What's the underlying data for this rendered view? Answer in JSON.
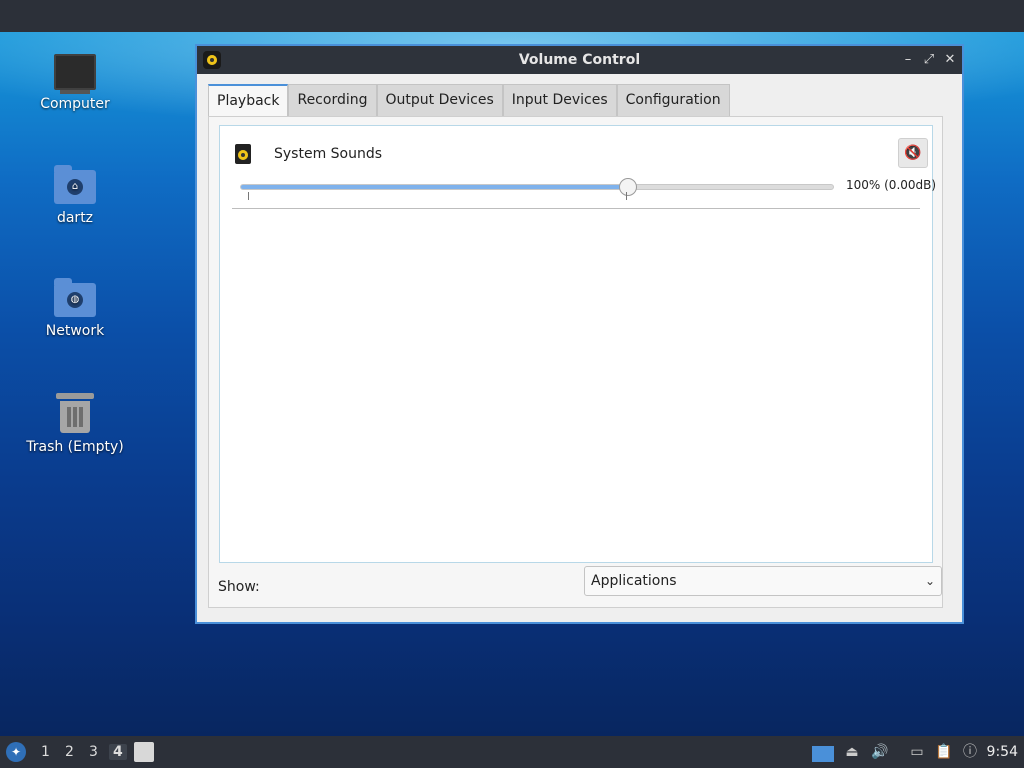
{
  "desktop": {
    "icons": [
      {
        "label": "Computer",
        "icon": "computer-icon"
      },
      {
        "label": "dartz",
        "icon": "home-folder-icon"
      },
      {
        "label": "Network",
        "icon": "network-folder-icon"
      },
      {
        "label": "Trash (Empty)",
        "icon": "trash-icon"
      }
    ]
  },
  "window": {
    "title": "Volume Control",
    "controls": [
      "minimize-icon",
      "maximize-icon",
      "close-icon"
    ],
    "tabs": [
      "Playback",
      "Recording",
      "Output Devices",
      "Input Devices",
      "Configuration"
    ],
    "active_tab": "Playback",
    "streams": [
      {
        "name": "System Sounds",
        "volume_percent": 100,
        "volume_label": "100% (0.00dB)",
        "muted": false
      }
    ],
    "show_label": "Show:",
    "show_value": "Applications"
  },
  "taskbar": {
    "workspaces": [
      "1",
      "2",
      "3",
      "4"
    ],
    "active_workspace": "4",
    "clock": "9:54",
    "tray_icons": [
      "display-icon",
      "eject-icon",
      "volume-icon",
      "network-icon",
      "clipboard-icon",
      "notification-icon"
    ]
  },
  "colors": {
    "accent": "#4a90d9",
    "titlebar": "#2e333b",
    "slider_fill": "#7fb2ec"
  }
}
